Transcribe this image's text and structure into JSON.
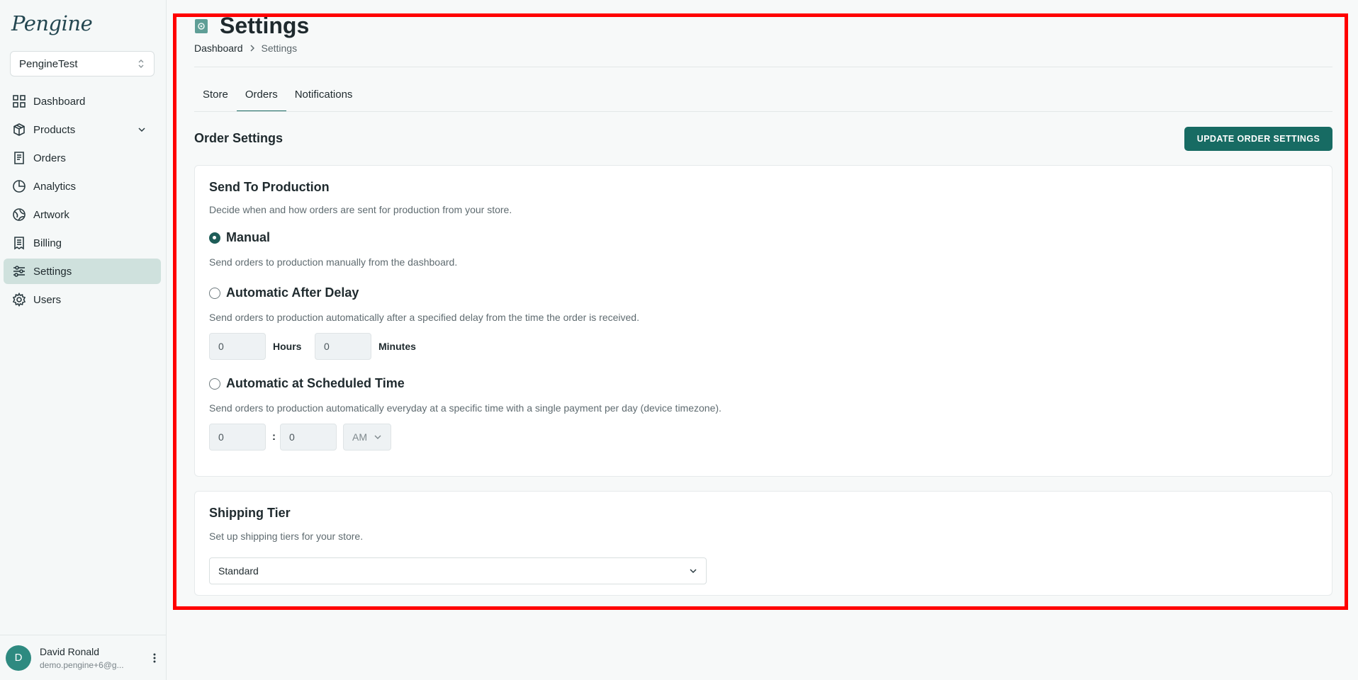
{
  "sidebar": {
    "logo": "Pengine",
    "store_selector": {
      "value": "PengineTest"
    },
    "items": [
      {
        "label": "Dashboard",
        "icon": "dashboard-icon"
      },
      {
        "label": "Products",
        "icon": "package-icon",
        "expandable": true
      },
      {
        "label": "Orders",
        "icon": "receipt-icon"
      },
      {
        "label": "Analytics",
        "icon": "pie-chart-icon"
      },
      {
        "label": "Artwork",
        "icon": "palette-icon"
      },
      {
        "label": "Billing",
        "icon": "invoice-icon"
      },
      {
        "label": "Settings",
        "icon": "sliders-icon",
        "active": true
      },
      {
        "label": "Users",
        "icon": "gear-user-icon"
      }
    ],
    "user": {
      "initial": "D",
      "name": "David Ronald",
      "email": "demo.pengine+6@g..."
    }
  },
  "header": {
    "title": "Settings",
    "breadcrumb": {
      "parent": "Dashboard",
      "current": "Settings"
    }
  },
  "tabs": [
    {
      "label": "Store"
    },
    {
      "label": "Orders",
      "active": true
    },
    {
      "label": "Notifications"
    }
  ],
  "order_settings": {
    "title": "Order Settings",
    "update_button": "UPDATE ORDER SETTINGS"
  },
  "send_to_production": {
    "title": "Send To Production",
    "description": "Decide when and how orders are sent for production from your store.",
    "options": {
      "manual": {
        "label": "Manual",
        "description": "Send orders to production manually from the dashboard.",
        "checked": true
      },
      "delay": {
        "label": "Automatic After Delay",
        "description": "Send orders to production automatically after a specified delay from the time the order is received.",
        "hours_value": "0",
        "hours_label": "Hours",
        "minutes_value": "0",
        "minutes_label": "Minutes"
      },
      "scheduled": {
        "label": "Automatic at Scheduled Time",
        "description": "Send orders to production automatically everyday at a specific time with a single payment per day (device timezone).",
        "hour_value": "0",
        "separator": ":",
        "minute_value": "0",
        "period": "AM"
      }
    }
  },
  "shipping_tier": {
    "title": "Shipping Tier",
    "description": "Set up shipping tiers for your store.",
    "selected": "Standard"
  },
  "colors": {
    "accent": "#176b63",
    "active_nav": "#cfe1dd",
    "highlight_border": "#ff0000"
  }
}
